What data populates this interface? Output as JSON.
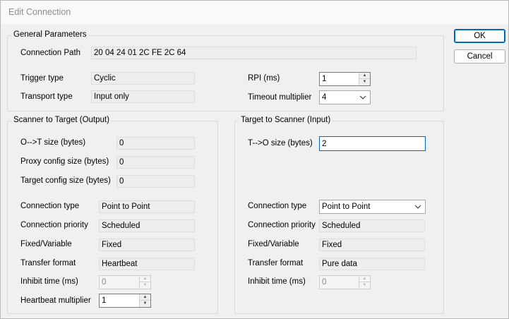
{
  "window": {
    "title": "Edit Connection"
  },
  "buttons": {
    "ok": "OK",
    "cancel": "Cancel"
  },
  "general": {
    "legend": "General Parameters",
    "connection_path_label": "Connection Path",
    "connection_path": "20 04 24 01 2C FE 2C 64",
    "trigger_type_label": "Trigger type",
    "trigger_type": "Cyclic",
    "transport_type_label": "Transport type",
    "transport_type": "Input only",
    "rpi_label": "RPI (ms)",
    "rpi": "1",
    "timeout_label": "Timeout multiplier",
    "timeout": "4"
  },
  "output": {
    "legend": "Scanner to Target (Output)",
    "ot_size_label": "O-->T size (bytes)",
    "ot_size": "0",
    "proxy_size_label": "Proxy config size (bytes)",
    "proxy_size": "0",
    "target_size_label": "Target config size (bytes)",
    "target_size": "0",
    "conn_type_label": "Connection type",
    "conn_type": "Point to Point",
    "priority_label": "Connection priority",
    "priority": "Scheduled",
    "fixed_var_label": "Fixed/Variable",
    "fixed_var": "Fixed",
    "transfer_label": "Transfer format",
    "transfer": "Heartbeat",
    "inhibit_label": "Inhibit time (ms)",
    "inhibit": "0",
    "heartbeat_label": "Heartbeat multiplier",
    "heartbeat": "1"
  },
  "input": {
    "legend": "Target to Scanner (Input)",
    "to_size_label": "T-->O size (bytes)",
    "to_size": "2",
    "conn_type_label": "Connection type",
    "conn_type": "Point to Point",
    "priority_label": "Connection priority",
    "priority": "Scheduled",
    "fixed_var_label": "Fixed/Variable",
    "fixed_var": "Fixed",
    "transfer_label": "Transfer format",
    "transfer": "Pure data",
    "inhibit_label": "Inhibit time (ms)",
    "inhibit": "0"
  }
}
